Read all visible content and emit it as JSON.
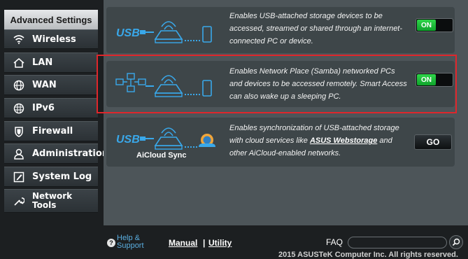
{
  "sidebar": {
    "header": "Advanced Settings",
    "items": [
      {
        "label": "Wireless",
        "icon": "wifi-icon"
      },
      {
        "label": "LAN",
        "icon": "home-icon"
      },
      {
        "label": "WAN",
        "icon": "globe-icon"
      },
      {
        "label": "IPv6",
        "icon": "globe-grid-icon"
      },
      {
        "label": "Firewall",
        "icon": "shield-icon"
      },
      {
        "label": "Administration",
        "icon": "person-icon"
      },
      {
        "label": "System Log",
        "icon": "edit-icon"
      },
      {
        "label": "Network",
        "label2": "Tools",
        "icon": "tools-icon"
      }
    ]
  },
  "features": [
    {
      "desc_lines": [
        "Enables USB-attached storage devices to be",
        "accessed, streamed or shared through an internet-",
        "connected PC or device."
      ],
      "toggle": "ON"
    },
    {
      "desc_lines": [
        "Enables Network Place (Samba) networked PCs",
        "and devices to be accessed remotely. Smart Access",
        "can also wake up a sleeping PC."
      ],
      "toggle": "ON"
    },
    {
      "label": "AiCloud Sync",
      "desc_line1": "Enables synchronization of USB-attached storage",
      "desc_line2_pre": "with cloud services like ",
      "desc_link": "ASUS Webstorage",
      "desc_line2_post": " and",
      "desc_line3": "other AiCloud-enabled networks.",
      "button": "GO"
    }
  ],
  "footer": {
    "help": "Help &",
    "support": "Support",
    "manual": "Manual",
    "separator": "|",
    "utility": "Utility",
    "faq": "FAQ",
    "copyright": "2015 ASUSTeK Computer Inc. All rights reserved."
  },
  "colors": {
    "toggle_on": "#1fbf3a",
    "highlight": "#e0262b",
    "link": "#5aaee0"
  }
}
